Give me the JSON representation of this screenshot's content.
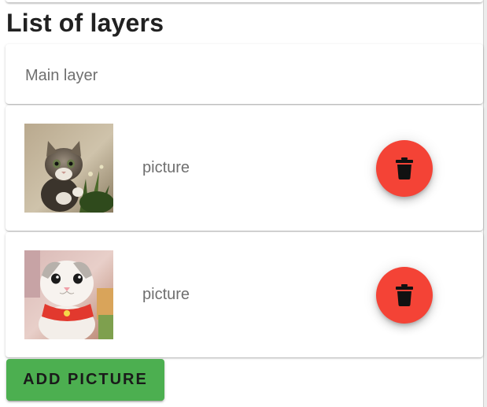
{
  "page": {
    "title": "List of layers"
  },
  "layers": {
    "main_layer_label": "Main layer",
    "items": [
      {
        "label": "picture",
        "thumbnail": "kitten-tabby-photo",
        "delete_icon": "trash-icon"
      },
      {
        "label": "picture",
        "thumbnail": "kitten-white-photo",
        "delete_icon": "trash-icon"
      }
    ]
  },
  "actions": {
    "add_picture_label": "ADD PICTURE"
  },
  "colors": {
    "delete_button": "#f44336",
    "add_button": "#4caf50",
    "title_text": "#212121",
    "secondary_text": "#6f6f6f"
  }
}
